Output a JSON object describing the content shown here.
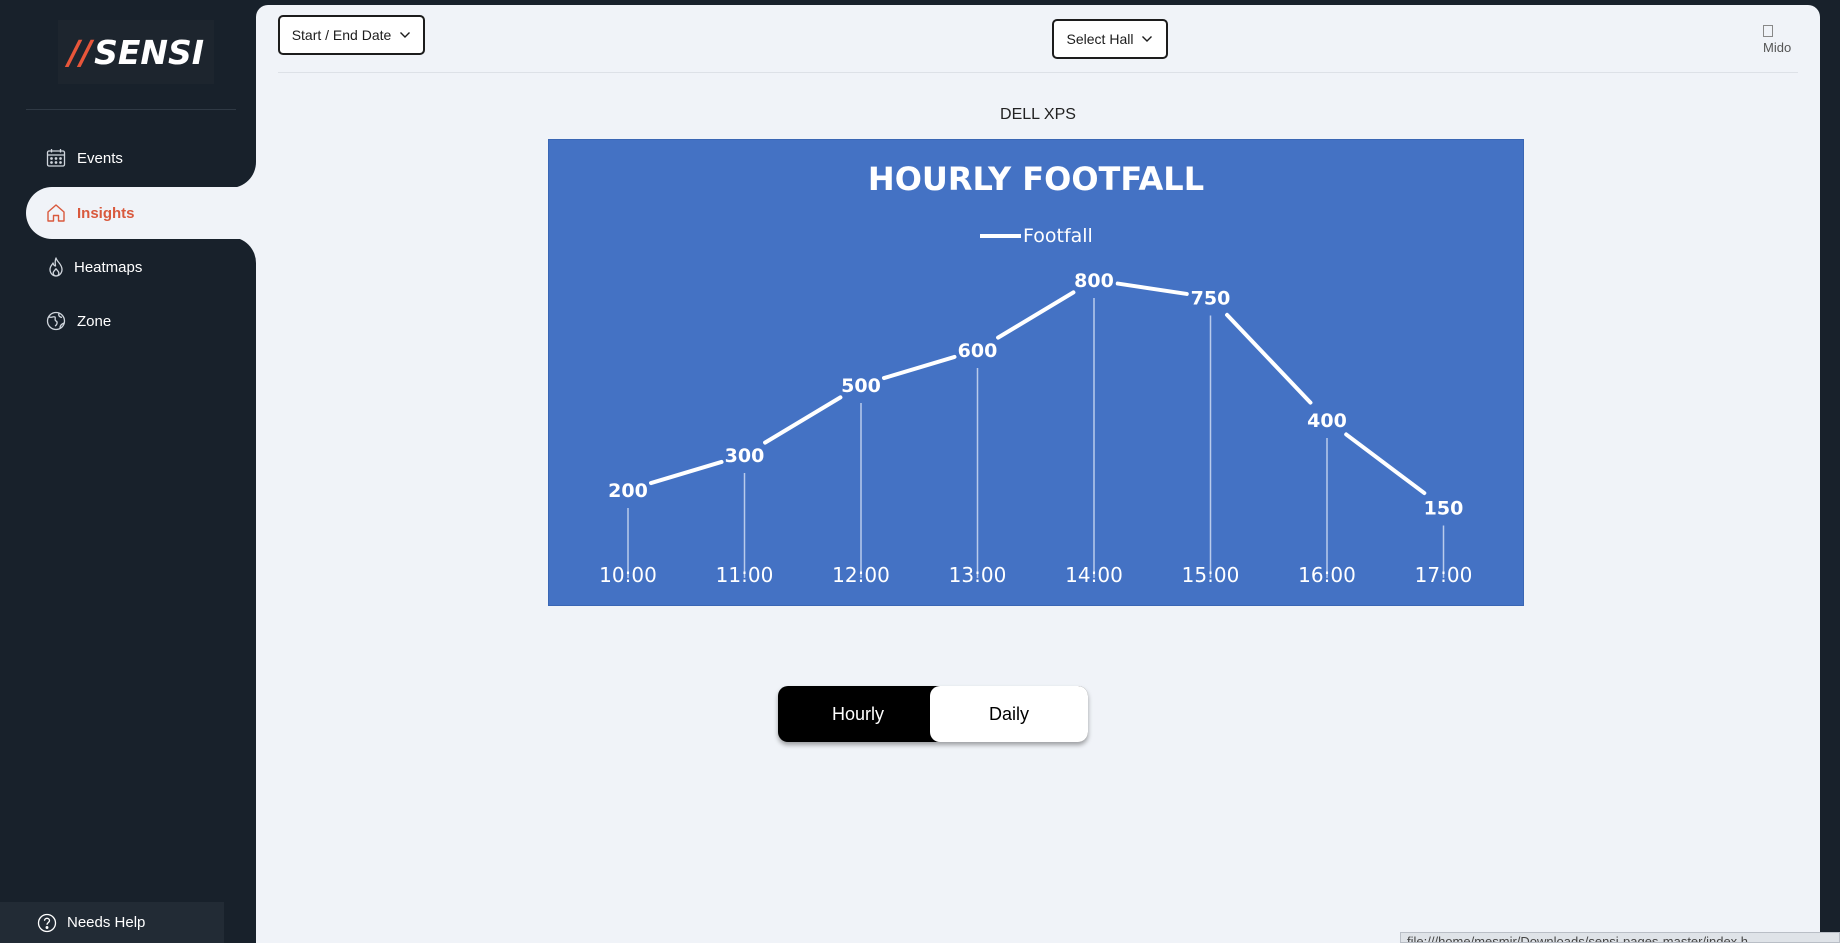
{
  "brand": {
    "logo_slashes": "//",
    "logo_text": "SENSI"
  },
  "sidebar": {
    "items": [
      {
        "label": "Events",
        "icon": "calendar-icon"
      },
      {
        "label": "Insights",
        "icon": "home-icon",
        "active": true
      },
      {
        "label": "Heatmaps",
        "icon": "flame-icon"
      },
      {
        "label": "Zone",
        "icon": "globe-icon"
      }
    ],
    "help_label": "Needs Help"
  },
  "header": {
    "date_dropdown_label": "Start / End Date",
    "hall_dropdown_label": "Select Hall",
    "avatar_alt": "Mido"
  },
  "main": {
    "product_title": "DELL XPS"
  },
  "chart_data": {
    "type": "line",
    "title": "HOURLY FOOTFALL",
    "legend": [
      "Footfall"
    ],
    "legend_position": "top",
    "categories": [
      "10:00",
      "11:00",
      "12:00",
      "13:00",
      "14:00",
      "15:00",
      "16:00",
      "17:00"
    ],
    "series": [
      {
        "name": "Footfall",
        "values": [
          200,
          300,
          500,
          600,
          800,
          750,
          400,
          150
        ]
      }
    ],
    "ylim": [
      0,
      900
    ],
    "grid": false,
    "colors": {
      "background": "#4472c4",
      "line": "#ffffff"
    }
  },
  "toggle": {
    "hourly_label": "Hourly",
    "daily_label": "Daily",
    "selected": "Daily"
  },
  "status_bar": {
    "url": "file:///home/mesmir/Downloads/sensi-pages-master/index.h"
  }
}
